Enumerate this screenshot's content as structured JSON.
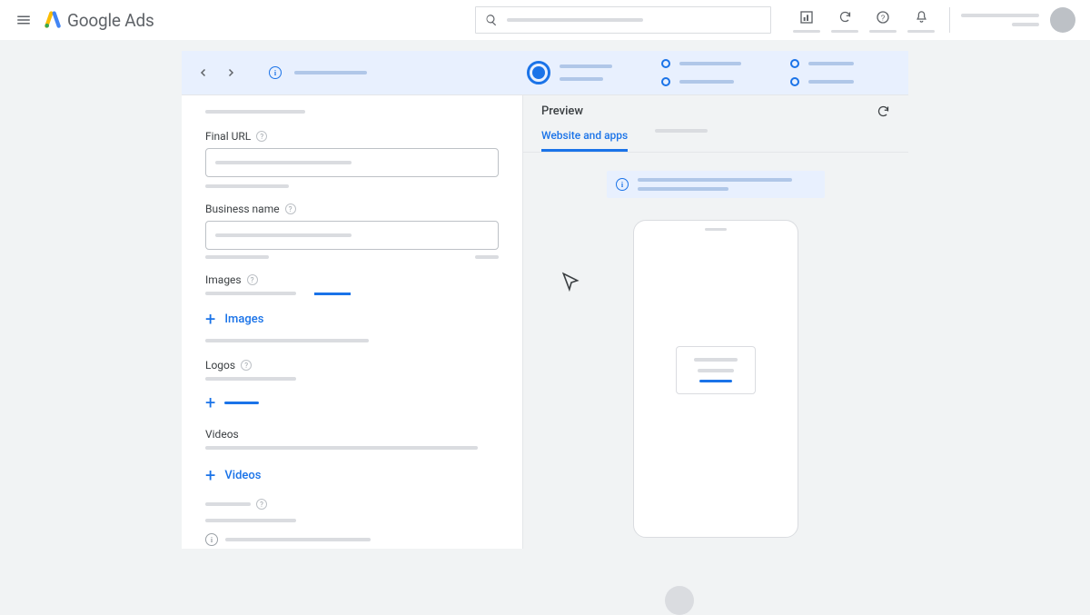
{
  "header": {
    "logo_product": "Google",
    "logo_suffix": "Ads"
  },
  "form": {
    "final_url_label": "Final URL",
    "business_name_label": "Business name",
    "images_label": "Images",
    "add_images_label": "Images",
    "logos_label": "Logos",
    "videos_label": "Videos",
    "add_videos_label": "Videos"
  },
  "preview": {
    "title": "Preview",
    "tab_active": "Website and apps"
  }
}
